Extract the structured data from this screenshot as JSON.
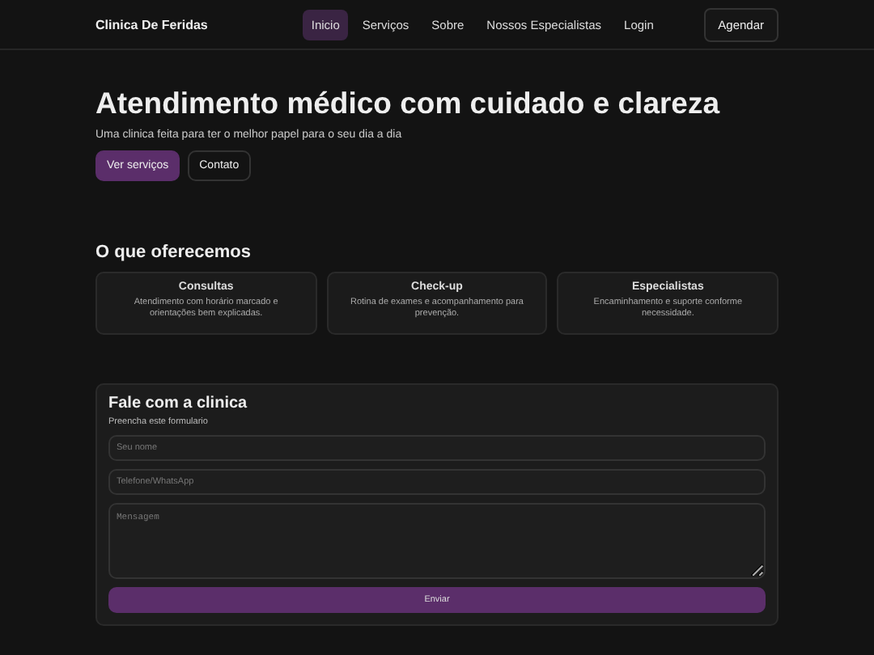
{
  "header": {
    "brand": "Clinica De Feridas",
    "nav": [
      {
        "label": "Inicio",
        "selected": true
      },
      {
        "label": "Serviços",
        "selected": false
      },
      {
        "label": "Sobre",
        "selected": false
      },
      {
        "label": "Nossos Especialistas",
        "selected": false
      },
      {
        "label": "Login",
        "selected": false
      }
    ],
    "cta": "Agendar"
  },
  "hero": {
    "title": "Atendimento médico com cuidado e clareza",
    "subtitle": "Uma clinica feita para ter o melhor papel para o seu dia a dia",
    "buttons": [
      {
        "label": "Ver serviços",
        "kind": "primary"
      },
      {
        "label": "Contato",
        "kind": "outline"
      }
    ]
  },
  "services": {
    "title": "O que oferecemos",
    "cards": [
      {
        "title": "Consultas",
        "text": "Atendimento com horário marcado e orientações bem explicadas."
      },
      {
        "title": "Check-up",
        "text": "Rotina de exames e acompanhamento para prevenção."
      },
      {
        "title": "Especialistas",
        "text": "Encaminhamento e suporte conforme necessidade."
      }
    ]
  },
  "contact": {
    "title": "Fale com a clinica",
    "subtitle": "Preencha este formulario",
    "fields": [
      {
        "placeholder": "Seu nome",
        "kind": "text"
      },
      {
        "placeholder": "Telefone/WhatsApp",
        "kind": "text"
      },
      {
        "placeholder": "Mensagem",
        "kind": "textarea"
      }
    ],
    "submit": "Enviar"
  }
}
